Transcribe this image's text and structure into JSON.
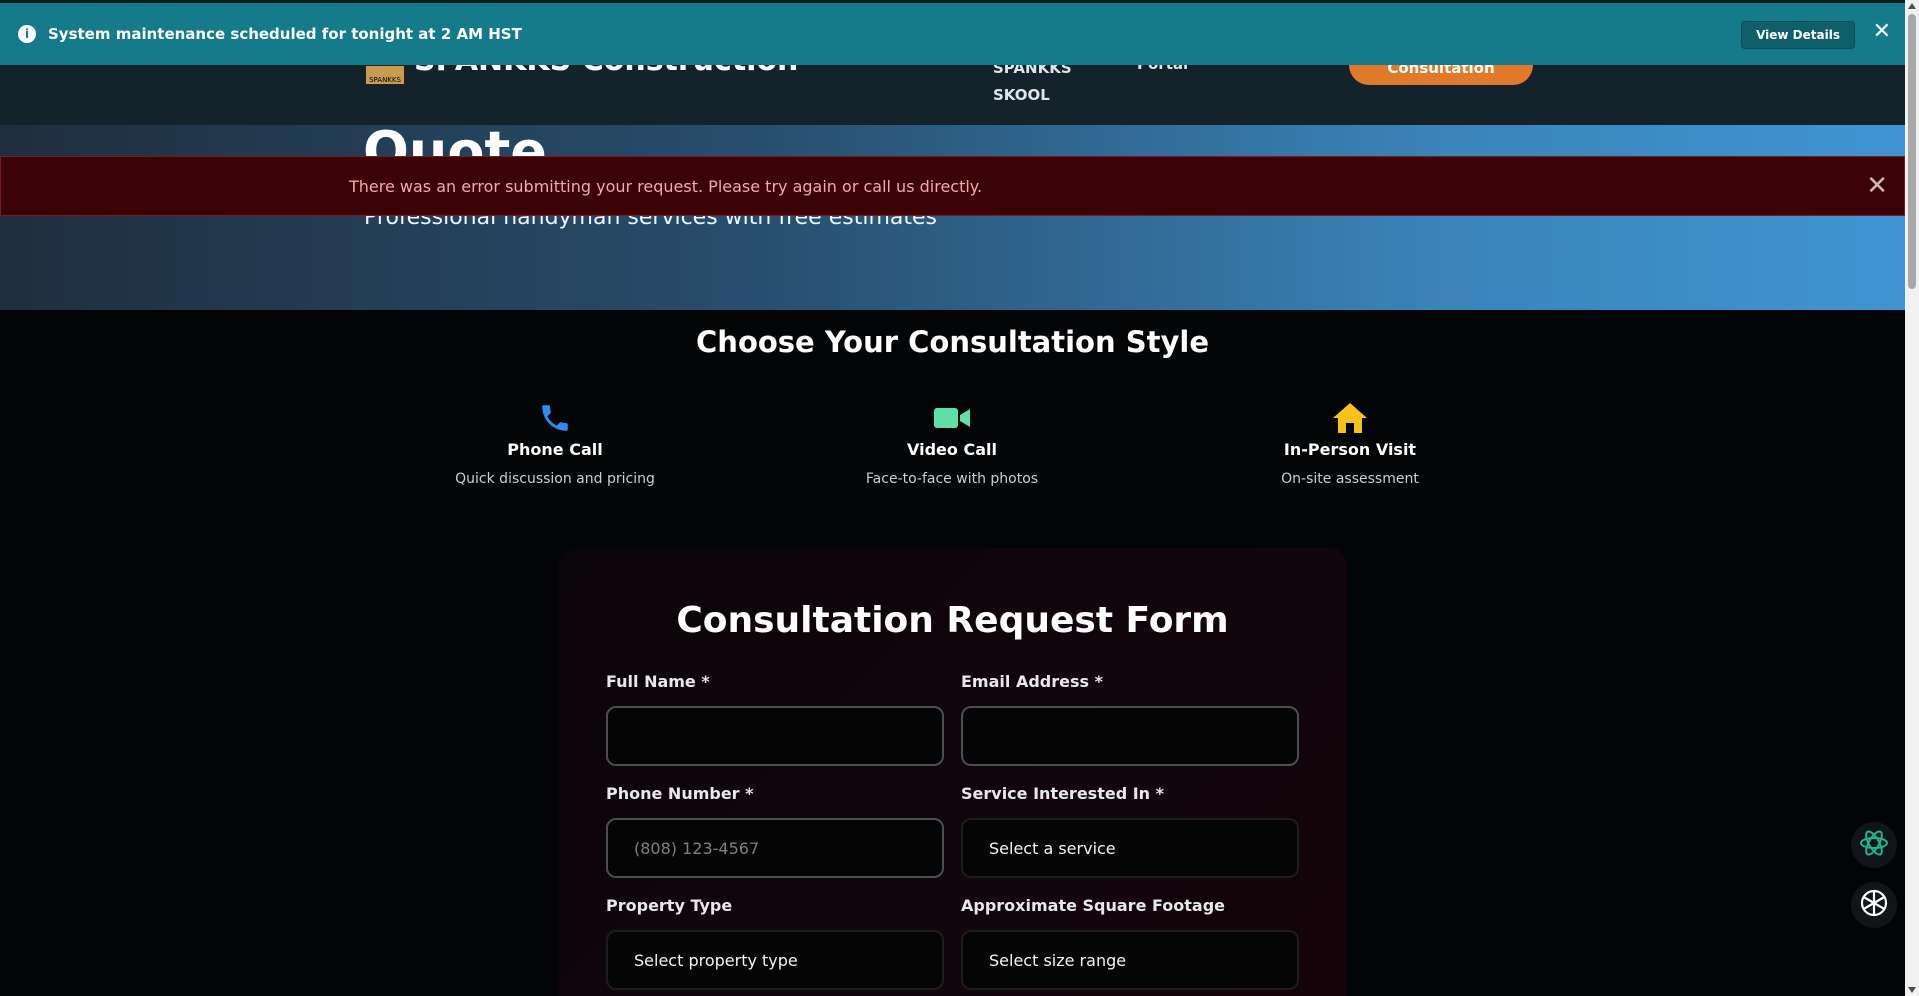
{
  "maintenance": {
    "message": "System maintenance scheduled for tonight at 2 AM HST",
    "details_label": "View Details",
    "close_glyph": "✕",
    "info_glyph": "i"
  },
  "nav": {
    "logo_text": "SPANKKS",
    "brand": "SPANKKS Construction",
    "link_skool": "SPANKKS\nSKOOL",
    "link_skool_top": "SPANKKS",
    "link_skool_bottom": "SKOOL",
    "link_portal": "Portal",
    "cta": "Consultation"
  },
  "hero": {
    "title": "Quote",
    "subtitle": "Professional handyman services with free estimates"
  },
  "error": {
    "message": "There was an error submitting your request. Please try again or call us directly.",
    "close_glyph": "✕"
  },
  "styles": {
    "title": "Choose Your Consultation Style",
    "options": [
      {
        "name": "Phone Call",
        "desc": "Quick discussion and pricing",
        "icon": "phone-icon",
        "color": "#2b8df2"
      },
      {
        "name": "Video Call",
        "desc": "Face-to-face with photos",
        "icon": "video-camera-icon",
        "color": "#5fe0a8"
      },
      {
        "name": "In-Person Visit",
        "desc": "On-site assessment",
        "icon": "house-icon",
        "color": "#f6c21c"
      }
    ]
  },
  "form": {
    "title": "Consultation Request Form",
    "full_name": {
      "label": "Full Name *",
      "value": ""
    },
    "email": {
      "label": "Email Address *",
      "value": ""
    },
    "phone": {
      "label": "Phone Number *",
      "placeholder": "(808) 123-4567"
    },
    "service": {
      "label": "Service Interested In *",
      "selected": "Select a service"
    },
    "property": {
      "label": "Property Type",
      "selected": "Select property type"
    },
    "sqft": {
      "label": "Approximate Square Footage",
      "selected": "Select size range"
    }
  },
  "colors": {
    "maintenance_bg": "#157b8a",
    "error_bg": "#3b0208",
    "error_text": "#f6a6ae",
    "cta": "#e07a2a"
  }
}
